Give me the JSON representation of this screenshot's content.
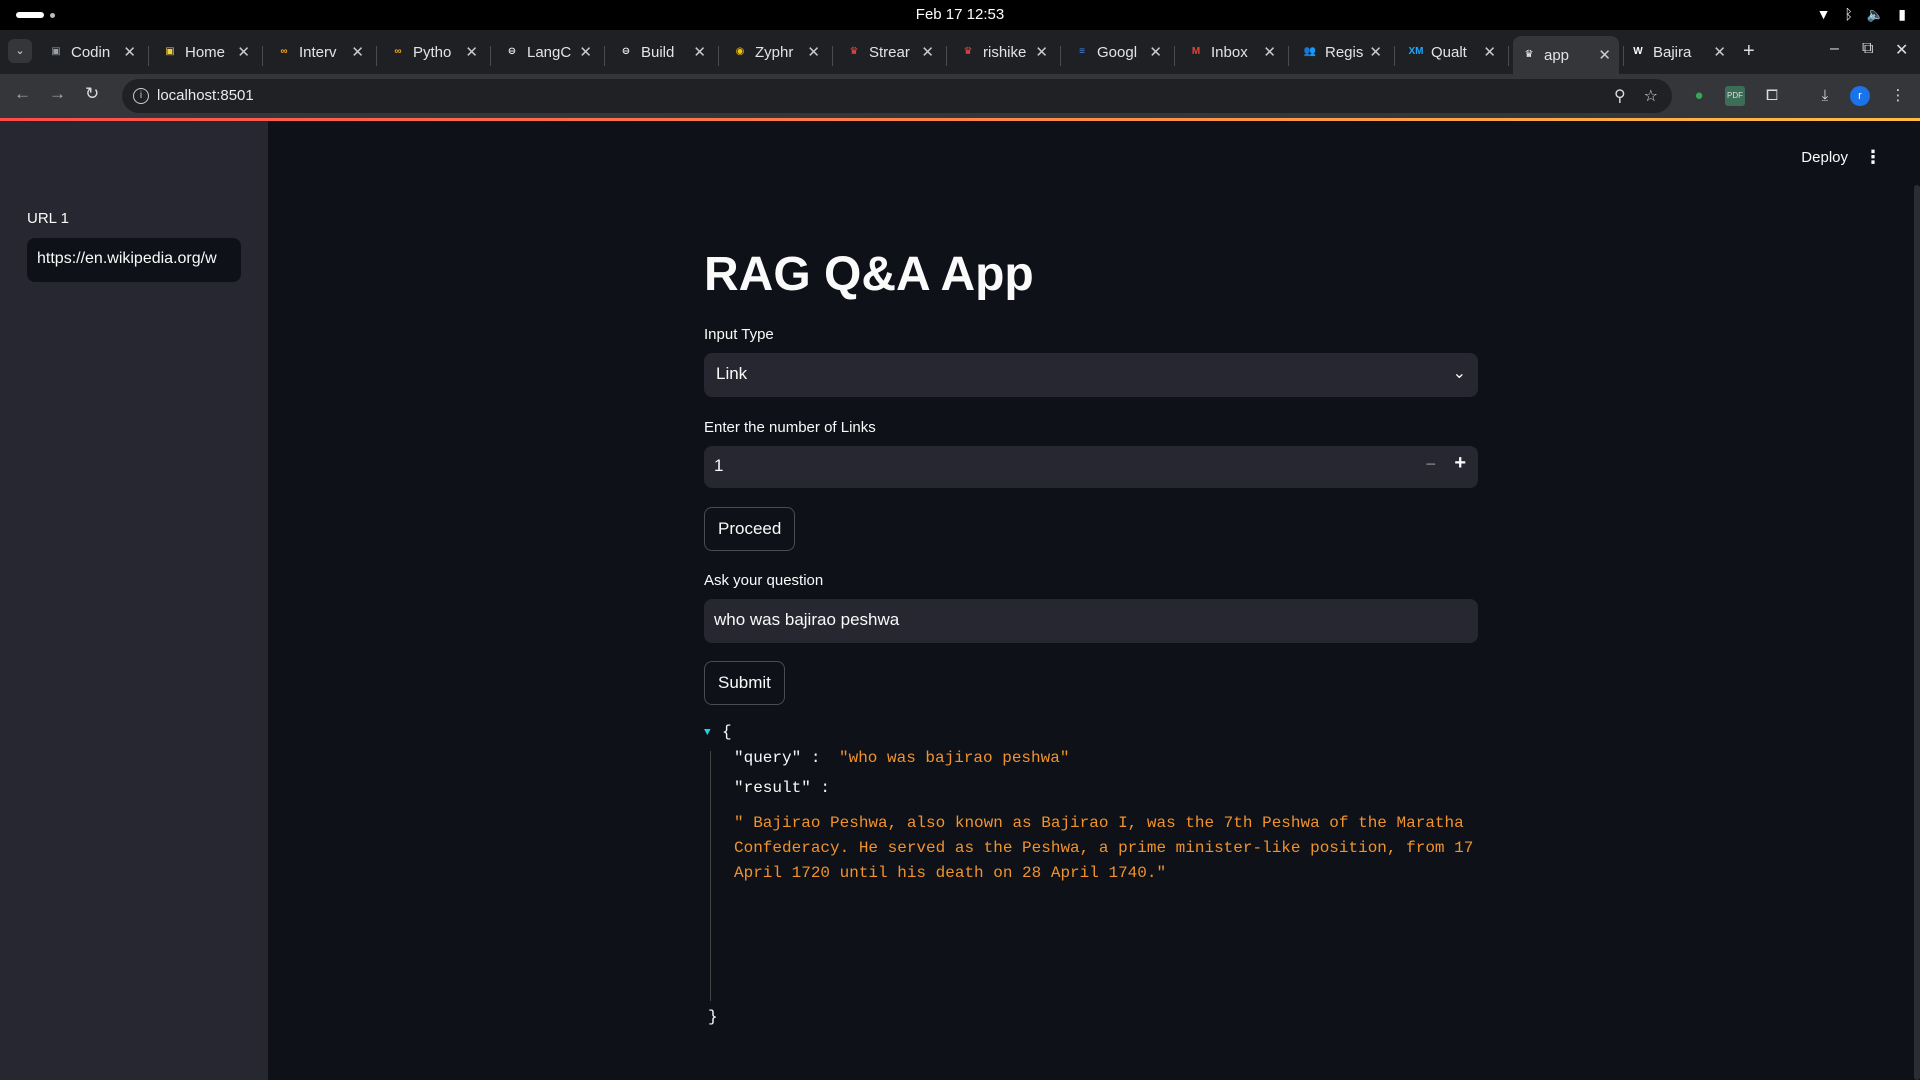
{
  "os": {
    "clock": "Feb 17  12:53"
  },
  "tabs": [
    {
      "title": "Codin",
      "icon": "coding-icon",
      "fav_color": "#9aa0a6",
      "fav_glyph": "▣"
    },
    {
      "title": "Home",
      "icon": "home-icon",
      "fav_color": "#f4d03f",
      "fav_glyph": "▣"
    },
    {
      "title": "Interv",
      "icon": "infinity-icon",
      "fav_color": "#f5a623",
      "fav_glyph": "∞"
    },
    {
      "title": "Pytho",
      "icon": "infinity-icon",
      "fav_color": "#f5a623",
      "fav_glyph": "∞"
    },
    {
      "title": "LangC",
      "icon": "chain-icon",
      "fav_color": "#e8eaed",
      "fav_glyph": "⊖"
    },
    {
      "title": "Build",
      "icon": "chain-icon",
      "fav_color": "#e8eaed",
      "fav_glyph": "⊖"
    },
    {
      "title": "Zyphr",
      "icon": "zyphra-icon",
      "fav_color": "#f4c20d",
      "fav_glyph": "◉"
    },
    {
      "title": "Strear",
      "icon": "streamlit-icon",
      "fav_color": "#ff4b4b",
      "fav_glyph": "♛"
    },
    {
      "title": "rishike",
      "icon": "streamlit-icon",
      "fav_color": "#ff4b4b",
      "fav_glyph": "♛"
    },
    {
      "title": "Googl",
      "icon": "google-docs-icon",
      "fav_color": "#4285f4",
      "fav_glyph": "≡"
    },
    {
      "title": "Inbox",
      "icon": "gmail-icon",
      "fav_color": "#ea4335",
      "fav_glyph": "M"
    },
    {
      "title": "Regist",
      "icon": "people-icon",
      "fav_color": "#4285f4",
      "fav_glyph": "👥"
    },
    {
      "title": "Qualt",
      "icon": "xm-icon",
      "fav_color": "#1ea7fd",
      "fav_glyph": "XM"
    },
    {
      "title": "app",
      "icon": "streamlit-icon",
      "fav_color": "#ffffff",
      "fav_glyph": "♛",
      "active": true
    },
    {
      "title": "Bajira",
      "icon": "wikipedia-icon",
      "fav_color": "#ffffff",
      "fav_glyph": "W"
    }
  ],
  "address": {
    "url": "localhost:8501"
  },
  "sidebar": {
    "url_label": "URL 1",
    "url_value": "https://en.wikipedia.org/w"
  },
  "header": {
    "deploy_label": "Deploy"
  },
  "main": {
    "title": "RAG Q&A App",
    "input_type_label": "Input Type",
    "input_type_value": "Link",
    "num_links_label": "Enter the number of Links",
    "num_links_value": "1",
    "proceed_label": "Proceed",
    "question_label": "Ask your question",
    "question_value": "who was bajirao peshwa",
    "submit_label": "Submit"
  },
  "json_output": {
    "open_brace": "{",
    "close_brace": "}",
    "query_key": "\"query\" :",
    "query_value": "\"who was bajirao peshwa\"",
    "result_key": "\"result\" :",
    "result_value": "\" Bajirao Peshwa, also known as Bajirao I, was the 7th Peshwa of the Maratha Confederacy. He served as the Peshwa, a prime minister-like position, from 17 April 1720 until his death on 28 April 1740.\""
  },
  "colors": {
    "accent": "#ff4b4b",
    "json_string": "#f0922e",
    "json_toggle": "#1ed2e0",
    "sidebar_bg": "#262730",
    "main_bg": "#0e1117"
  }
}
